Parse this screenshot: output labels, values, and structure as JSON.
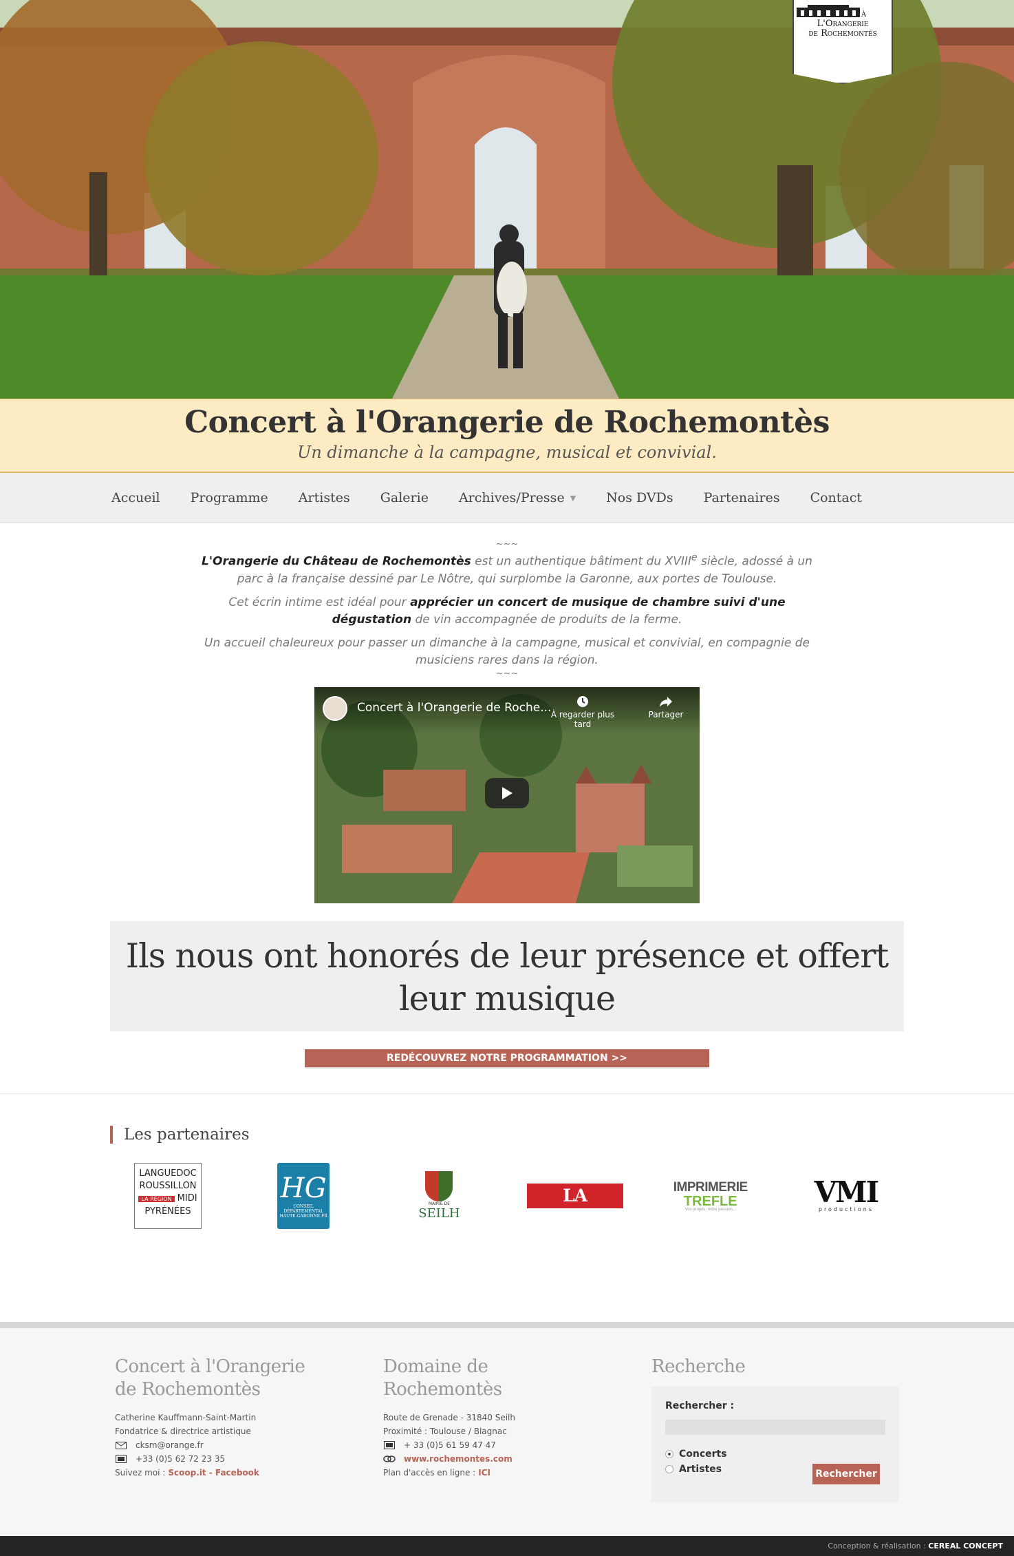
{
  "logo": {
    "line1": "Concert à",
    "line2": "L'Orangerie",
    "line3": "de Rochemontès"
  },
  "header": {
    "title": "Concert à l'Orangerie de Rochemontès",
    "tagline": "Un dimanche à la campagne, musical et convivial."
  },
  "nav": {
    "items": [
      {
        "label": "Accueil"
      },
      {
        "label": "Programme"
      },
      {
        "label": "Artistes"
      },
      {
        "label": "Galerie"
      },
      {
        "label": "Archives/Presse"
      },
      {
        "label": "Nos DVDs"
      },
      {
        "label": "Partenaires"
      },
      {
        "label": "Contact"
      }
    ]
  },
  "intro": {
    "tilde": "~~~",
    "p1_bold": "L'Orangerie du Château de Rochemontès",
    "p1_text": " est un authentique bâtiment du XVIII",
    "p1_sup": "e",
    "p1_text2": " siècle, adossé à un parc à la française dessiné par Le Nôtre, qui surplombe la Garonne, aux portes de Toulouse.",
    "p2_text": "Cet écrin intime est idéal pour ",
    "p2_bold": "apprécier un concert de musique de chambre suivi d'une dégustation",
    "p2_text2": " de vin accompagnée de produits de la ferme.",
    "p3_text": "Un accueil chaleureux pour passer un dimanche à la campagne, musical et convivial, en compagnie de musiciens rares dans la région."
  },
  "video": {
    "title": "Concert à l'Orangerie de Roche...",
    "later": "À regarder plus tard",
    "share": "Partager"
  },
  "honor": {
    "heading": "Ils nous ont honorés de leur présence et offert leur musique",
    "button": "REDÉCOUVREZ NOTRE PROGRAMMATION >>"
  },
  "partners": {
    "heading": "Les partenaires",
    "lr": {
      "l1": "LANGUEDOC",
      "l2": "ROUSSILLON",
      "reg": "LA RÉGION",
      "l3": "MIDI",
      "l4": "PYRÉNÉES"
    },
    "hg": {
      "big": "HG",
      "small": "CONSEIL DÉPARTEMENTAL HAUTE-GARONNE.FR"
    },
    "seilh": {
      "mairie": "MAIRIE DE",
      "name": "SEILH"
    },
    "depeche": "LA DÉPÊCHE",
    "trefle": {
      "a": "IMPRIMERIE",
      "b": "TREFLE",
      "c": "Vos projets, notre passion..."
    },
    "vm": {
      "big": "VMI",
      "small": "productions"
    }
  },
  "footer": {
    "col1": {
      "title": "Concert à l'Orangerie de Rochemontès",
      "name": "Catherine Kauffmann-Saint-Martin",
      "role": "Fondatrice & directrice artistique",
      "email": "cksm@orange.fr",
      "phone": "+33 (0)5 62 72 23 35",
      "follow": "Suivez moi :",
      "links": "Scoop.it - Facebook"
    },
    "col2": {
      "title": "Domaine de Rochemontès",
      "address": "Route de Grenade - 31840 Seilh",
      "near": "Proximité : Toulouse / Blagnac",
      "phone": "+ 33 (0)5 61 59 47 47",
      "site": "www.rochemontes.com",
      "plan": "Plan d'accès en ligne :",
      "plan_link": "ICI"
    },
    "col3": {
      "title": "Recherche",
      "label": "Rechercher :",
      "input_value": "",
      "opt1": "Concerts",
      "opt2": "Artistes",
      "selected": "Concerts",
      "button": "Rechercher"
    }
  },
  "bottombar": {
    "text": "Conception & réalisation :",
    "brand": "CEREAL CONCEPT"
  },
  "colors": {
    "accent": "#b76355",
    "title_bg": "#fdebc4",
    "nav_bg": "#efefef"
  }
}
